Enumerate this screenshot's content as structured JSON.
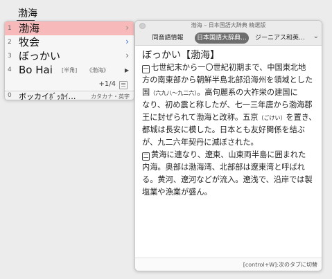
{
  "input": {
    "text": "渤海"
  },
  "candidates": {
    "items": [
      {
        "num": "1",
        "text": "渤海",
        "arrow": "›",
        "selected": true
      },
      {
        "num": "2",
        "text": "牧会",
        "arrow": "›"
      },
      {
        "num": "3",
        "text": "ぼっかい",
        "arrow": "›"
      },
      {
        "num": "4",
        "text": "Bo Hai",
        "tag1": "[半角]",
        "tag2": "《渤海》",
        "arrow": "▶"
      }
    ],
    "pager": "1/4",
    "pager_prefix": "+",
    "bottom": {
      "num": "0",
      "text": "ボッカイﾎﾞｯｶｲ…",
      "type": "カタカナ・英字"
    }
  },
  "dictionary": {
    "window_title": "渤海 – 日本国語大辞典 精選版",
    "tabs": [
      "同音語情報",
      "日本国語大辞典…",
      "ジーニアス和英…"
    ],
    "active_tab": 1,
    "chevron_icon": "chevron-down-icon",
    "headword": "ぼっかい【渤海】",
    "sense1_icon": "一",
    "sense2_icon": "二",
    "lines": [
      "七世紀末から一〇世紀初期まで、中国東北地",
      "方の南東部から朝鮮半島北部沿海州を領域とした",
      "国",
      "（六九八〜九二六）",
      "。高句麗系の大祚栄の建国に",
      "なり、初め震と称したが、七一三年唐から渤海郡",
      "王に封ぜられて渤海と改称。五京",
      "（ごけい）",
      "を置き、",
      "都城は長安に模した。日本とも友好関係を結ぶ",
      "が、九二六年契丹に滅ぼされた。",
      "黄海に連なり、遼東、山東両半島に囲まれた",
      "内海。奥部は渤海湾、北部部は遼東湾と呼ばれ",
      "る。黄河、遼河などが流入。遼浅で、沿岸では製",
      "塩業や漁業が盛ん。"
    ],
    "footer_hint": "[control+W]:次のタブに切替"
  }
}
